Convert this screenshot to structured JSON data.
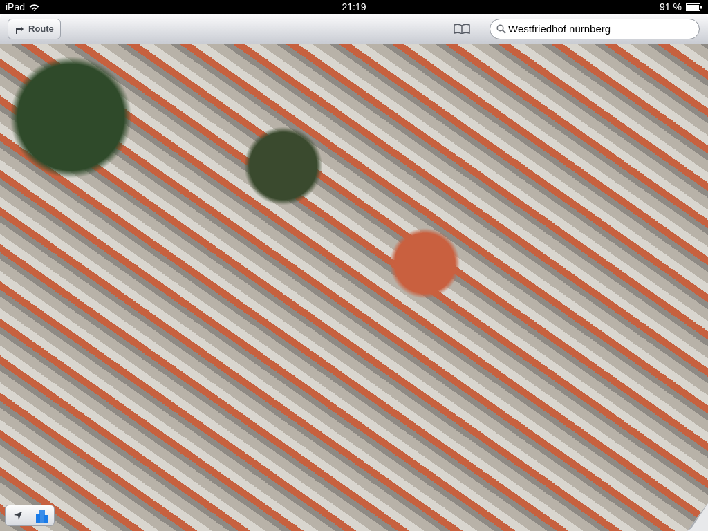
{
  "status_bar": {
    "device": "iPad",
    "time": "21:19",
    "battery": "91 %"
  },
  "toolbar": {
    "route_button": "Route",
    "search": {
      "value": "Westfriedhof nürnberg"
    }
  },
  "map_controls": [
    {
      "kind": "location",
      "selected": false
    },
    {
      "kind": "buildings",
      "selected": true
    }
  ]
}
